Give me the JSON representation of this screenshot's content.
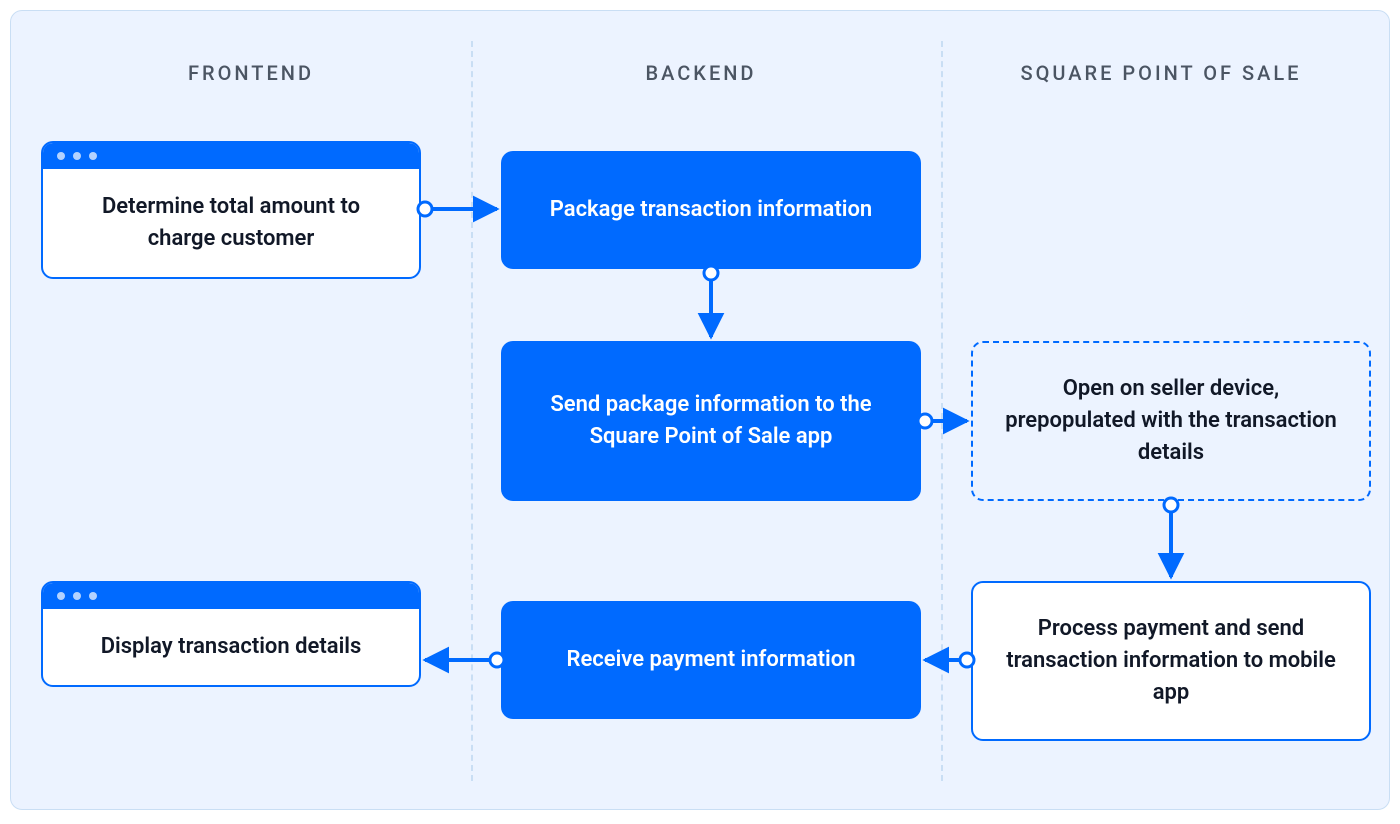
{
  "columns": {
    "frontend": "FRONTEND",
    "backend": "BACKEND",
    "pos": "SQUARE POINT OF SALE"
  },
  "nodes": {
    "determine_total": "Determine total amount to charge customer",
    "package_transaction": "Package transaction information",
    "send_package": "Send package information to the Square Point of Sale app",
    "open_device": "Open on seller device, prepopulated with the transaction details",
    "process_payment": "Process payment and send transaction information to mobile app",
    "receive_payment": "Receive payment information",
    "display_details": "Display transaction details"
  }
}
